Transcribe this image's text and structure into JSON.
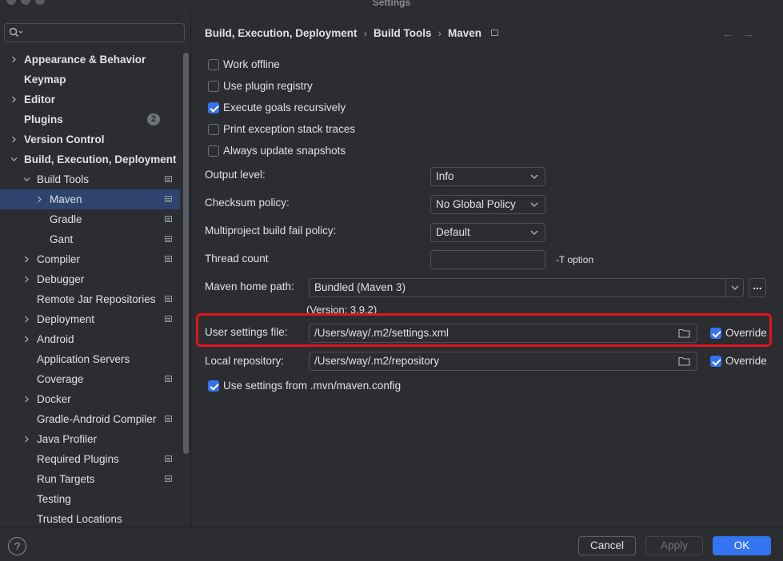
{
  "window": {
    "title": "Settings"
  },
  "search": {
    "placeholder": ""
  },
  "sidebar": {
    "items": [
      {
        "label": "Appearance & Behavior",
        "expandable": true,
        "bold": true,
        "indent": 0
      },
      {
        "label": "Keymap",
        "expandable": false,
        "bold": true,
        "indent": 0
      },
      {
        "label": "Editor",
        "expandable": true,
        "bold": true,
        "indent": 0
      },
      {
        "label": "Plugins",
        "expandable": false,
        "bold": true,
        "indent": 0,
        "badge": "2"
      },
      {
        "label": "Version Control",
        "expandable": true,
        "bold": true,
        "indent": 0
      },
      {
        "label": "Build, Execution, Deployment",
        "expandable": true,
        "expanded": true,
        "bold": true,
        "indent": 0
      },
      {
        "label": "Build Tools",
        "expandable": true,
        "expanded": true,
        "indent": 1,
        "page_icon": true
      },
      {
        "label": "Maven",
        "expandable": true,
        "indent": 2,
        "selected": true,
        "page_icon": true
      },
      {
        "label": "Gradle",
        "expandable": false,
        "indent": 2,
        "page_icon": true
      },
      {
        "label": "Gant",
        "expandable": false,
        "indent": 2,
        "page_icon": true
      },
      {
        "label": "Compiler",
        "expandable": true,
        "indent": 1,
        "page_icon": true
      },
      {
        "label": "Debugger",
        "expandable": true,
        "indent": 1
      },
      {
        "label": "Remote Jar Repositories",
        "expandable": false,
        "indent": 1,
        "page_icon": true
      },
      {
        "label": "Deployment",
        "expandable": true,
        "indent": 1,
        "page_icon": true
      },
      {
        "label": "Android",
        "expandable": true,
        "indent": 1
      },
      {
        "label": "Application Servers",
        "expandable": false,
        "indent": 1
      },
      {
        "label": "Coverage",
        "expandable": false,
        "indent": 1,
        "page_icon": true
      },
      {
        "label": "Docker",
        "expandable": true,
        "indent": 1
      },
      {
        "label": "Gradle-Android Compiler",
        "expandable": false,
        "indent": 1,
        "page_icon": true
      },
      {
        "label": "Java Profiler",
        "expandable": true,
        "indent": 1
      },
      {
        "label": "Required Plugins",
        "expandable": false,
        "indent": 1,
        "page_icon": true
      },
      {
        "label": "Run Targets",
        "expandable": false,
        "indent": 1,
        "page_icon": true
      },
      {
        "label": "Testing",
        "expandable": false,
        "indent": 1
      },
      {
        "label": "Trusted Locations",
        "expandable": false,
        "indent": 1
      }
    ]
  },
  "breadcrumb": {
    "items": [
      "Build, Execution, Deployment",
      "Build Tools",
      "Maven"
    ],
    "separator": "›"
  },
  "nav": {
    "back": "←",
    "forward": "→"
  },
  "checkboxes": [
    {
      "label": "Work offline",
      "checked": false
    },
    {
      "label": "Use plugin registry",
      "checked": false
    },
    {
      "label": "Execute goals recursively",
      "checked": true
    },
    {
      "label": "Print exception stack traces",
      "checked": false
    },
    {
      "label": "Always update snapshots",
      "checked": false
    }
  ],
  "form": {
    "output_level": {
      "label": "Output level:",
      "value": "Info"
    },
    "checksum_policy": {
      "label": "Checksum policy:",
      "value": "No Global Policy"
    },
    "multiproject_fail_policy": {
      "label": "Multiproject build fail policy:",
      "value": "Default"
    },
    "thread_count": {
      "label": "Thread count",
      "value": "",
      "note": "-T option"
    },
    "maven_home": {
      "label": "Maven home path:",
      "value": "Bundled (Maven 3)",
      "version": "(Version: 3.9.2)",
      "browse": "..."
    },
    "user_settings": {
      "label": "User settings file:",
      "value": "/Users/way/.m2/settings.xml",
      "override_label": "Override",
      "override_checked": true
    },
    "local_repository": {
      "label": "Local repository:",
      "value": "/Users/way/.m2/repository",
      "override_label": "Override",
      "override_checked": true
    },
    "use_mvn_config": {
      "label": "Use settings from .mvn/maven.config",
      "checked": true
    }
  },
  "footer": {
    "help": "?",
    "cancel": "Cancel",
    "apply": "Apply",
    "ok": "OK"
  },
  "colors": {
    "background": "#2b2d30",
    "accent": "#3574f0",
    "selection": "#2e436e",
    "highlight_box": "#e0141e"
  }
}
